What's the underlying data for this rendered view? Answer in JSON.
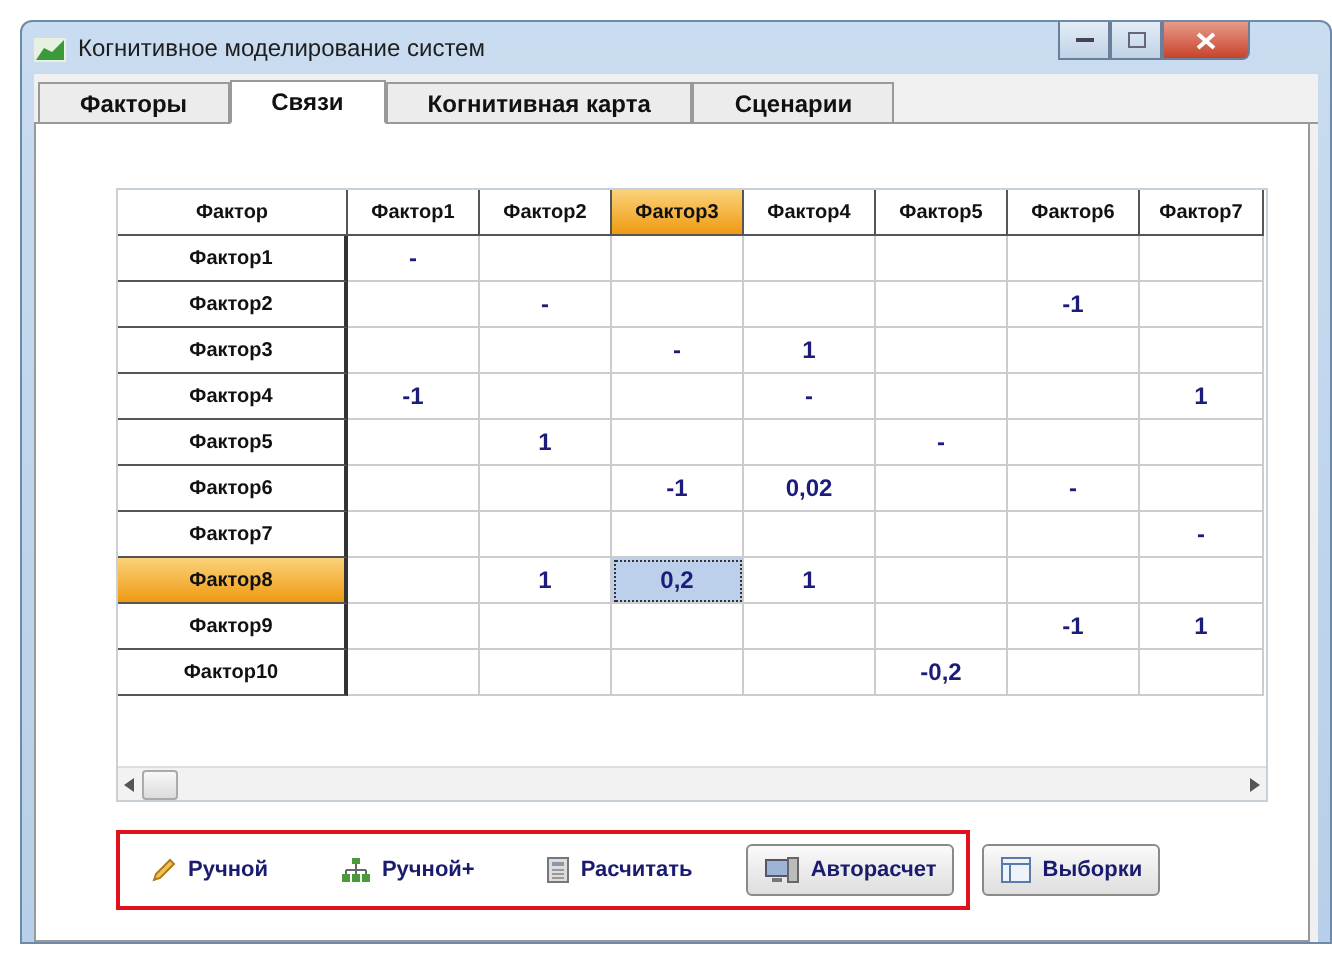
{
  "window": {
    "title": "Когнитивное моделирование систем"
  },
  "tabs": [
    {
      "label": "Факторы",
      "selected": false
    },
    {
      "label": "Связи",
      "selected": true
    },
    {
      "label": "Когнитивная карта",
      "selected": false
    },
    {
      "label": "Сценарии",
      "selected": false
    }
  ],
  "table": {
    "corner": "Фактор",
    "columns": [
      {
        "label": "Фактор1",
        "selected": false
      },
      {
        "label": "Фактор2",
        "selected": false
      },
      {
        "label": "Фактор3",
        "selected": true
      },
      {
        "label": "Фактор4",
        "selected": false
      },
      {
        "label": "Фактор5",
        "selected": false
      },
      {
        "label": "Фактор6",
        "selected": false
      },
      {
        "label": "Фактор7",
        "selected": false
      }
    ],
    "rows": [
      {
        "label": "Фактор1",
        "selected": false,
        "cells": [
          "-",
          null,
          null,
          null,
          null,
          null,
          null
        ]
      },
      {
        "label": "Фактор2",
        "selected": false,
        "cells": [
          null,
          "-",
          null,
          null,
          null,
          "-1",
          null
        ]
      },
      {
        "label": "Фактор3",
        "selected": false,
        "cells": [
          null,
          null,
          "-",
          "1",
          null,
          null,
          null
        ]
      },
      {
        "label": "Фактор4",
        "selected": false,
        "cells": [
          "-1",
          null,
          null,
          "-",
          null,
          null,
          "1"
        ]
      },
      {
        "label": "Фактор5",
        "selected": false,
        "cells": [
          null,
          "1",
          null,
          null,
          "-",
          null,
          null
        ]
      },
      {
        "label": "Фактор6",
        "selected": false,
        "cells": [
          null,
          null,
          "-1",
          "0,02",
          null,
          "-",
          null
        ]
      },
      {
        "label": "Фактор7",
        "selected": false,
        "cells": [
          null,
          null,
          null,
          null,
          null,
          null,
          "-"
        ]
      },
      {
        "label": "Фактор8",
        "selected": true,
        "cells": [
          null,
          "1",
          "0,2",
          "1",
          null,
          null,
          null
        ]
      },
      {
        "label": "Фактор9",
        "selected": false,
        "cells": [
          null,
          null,
          null,
          null,
          null,
          "-1",
          "1"
        ]
      },
      {
        "label": "Фактор10",
        "selected": false,
        "cells": [
          null,
          null,
          null,
          null,
          "-0,2",
          null,
          null
        ]
      }
    ]
  },
  "toolbar": {
    "highlighted": true,
    "buttons": [
      {
        "label": "Ручной",
        "kind": "flat"
      },
      {
        "label": "Ручной+",
        "kind": "flat"
      },
      {
        "label": "Расчитать",
        "kind": "flat"
      },
      {
        "label": "Авторасчет",
        "kind": "raised"
      }
    ]
  },
  "side_button": {
    "label": "Выборки",
    "kind": "raised"
  }
}
